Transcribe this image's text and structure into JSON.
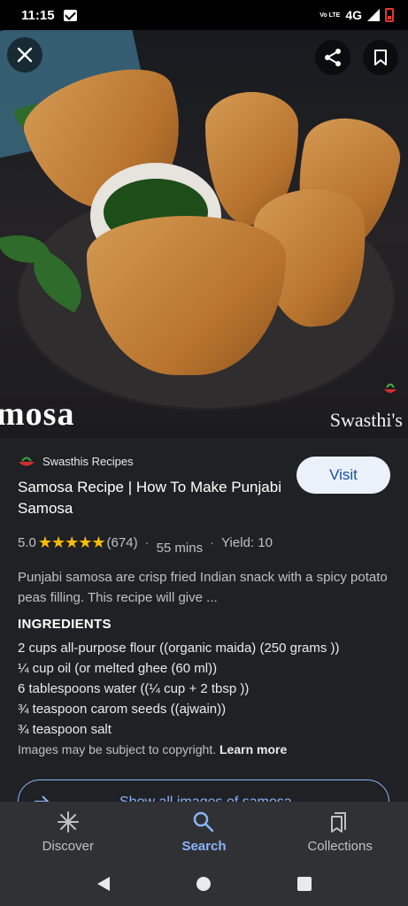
{
  "status_bar": {
    "time": "11:15",
    "network": "4G",
    "volte": "Vo LTE"
  },
  "hero": {
    "overlay_text": "mosa",
    "watermark": "Swasthi's",
    "close_icon": "close-icon",
    "share_icon": "share-icon",
    "bookmark_icon": "bookmark-icon"
  },
  "result": {
    "source_name": "Swasthis Recipes",
    "visit_label": "Visit",
    "title": "Samosa Recipe | How To Make Punjabi Samosa",
    "rating": "5.0",
    "stars": "★★★★★",
    "rating_count": "(674)",
    "duration": "55 mins",
    "yield": "Yield: 10",
    "description": "Punjabi samosa are crisp fried Indian snack with a spicy potato peas filling. This recipe will give ...",
    "ingredients_heading": "INGREDIENTS",
    "ingredients": [
      "2 cups all-purpose flour ((organic maida) (250 grams ))",
      "¼ cup oil (or melted ghee (60 ml))",
      "6 tablespoons water ((¼ cup + 2 tbsp ))",
      "¾ teaspoon carom seeds ((ajwain))",
      "¾ teaspoon salt"
    ],
    "copyright": "Images may be subject to copyright.",
    "learn_more": "Learn more",
    "show_all": "Show all images of samosa"
  },
  "bottom_nav": [
    {
      "label": "Discover",
      "icon": "discover-icon"
    },
    {
      "label": "Search",
      "icon": "search-icon"
    },
    {
      "label": "Collections",
      "icon": "collections-icon"
    }
  ],
  "colors": {
    "accent": "#8ab4f8",
    "star": "#fbbc04",
    "background": "#202124"
  }
}
